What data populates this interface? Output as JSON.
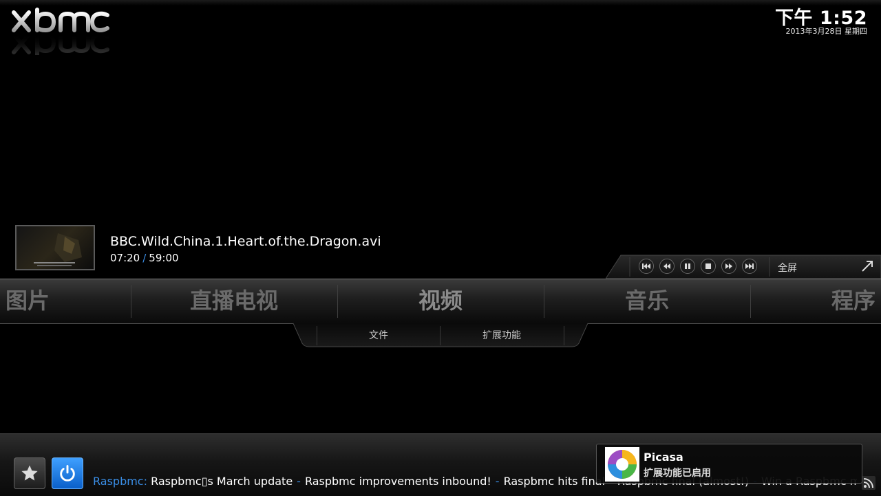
{
  "app": {
    "logo": "xbmc"
  },
  "clock": {
    "time": "下午 1:52",
    "date": "2013年3月28日 星期四"
  },
  "now_playing": {
    "title": "BBC.Wild.China.1.Heart.of.the.Dragon.avi",
    "elapsed": "07:20",
    "separator": "/",
    "duration": "59:00"
  },
  "player_controls": {
    "buttons": [
      "skip-previous-icon",
      "rewind-icon",
      "pause-icon",
      "stop-icon",
      "fast-forward-icon",
      "skip-next-icon"
    ],
    "fullscreen_label": "全屏"
  },
  "main_menu": {
    "items": [
      {
        "label": "图片"
      },
      {
        "label": "直播电视"
      },
      {
        "label": "视频",
        "active": true
      },
      {
        "label": "音乐"
      },
      {
        "label": "程序"
      }
    ]
  },
  "submenu": {
    "items": [
      {
        "label": "文件"
      },
      {
        "label": "扩展功能"
      }
    ]
  },
  "bottom": {
    "ticker": {
      "source": "Raspbmc:",
      "separator": "-",
      "headlines": [
        "Raspbmc▯s March update",
        "Raspbmc improvements inbound!",
        "Raspbmc hits final",
        "Raspbmc final (almost!)",
        "Win a Raspbmc media ce"
      ]
    }
  },
  "notification": {
    "title": "Picasa",
    "message": "扩展功能已启用"
  },
  "colors": {
    "accent": "#3a8ee6",
    "power_button": "#1e7ee6",
    "menu_text": "#6a6a6a"
  }
}
